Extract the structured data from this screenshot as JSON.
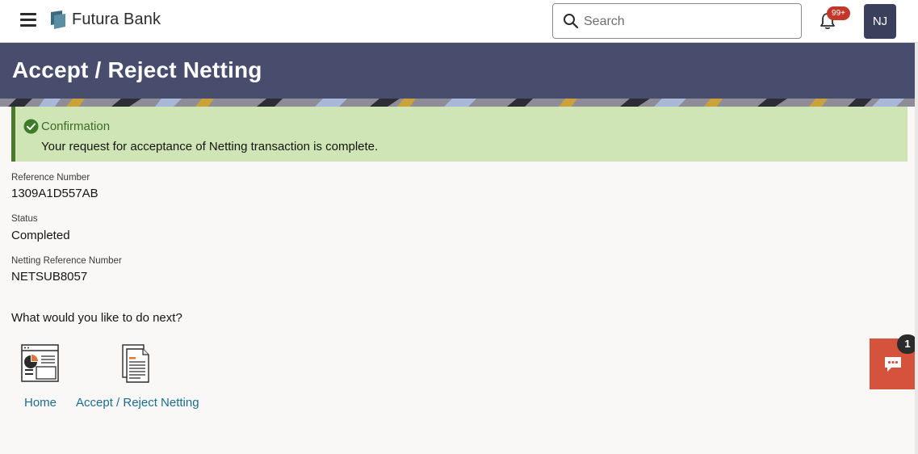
{
  "header": {
    "brand": "Futura Bank",
    "search_placeholder": "Search",
    "notification_count": "99+",
    "user_initials": "NJ"
  },
  "page": {
    "title": "Accept / Reject Netting"
  },
  "confirmation": {
    "title": "Confirmation",
    "message": "Your request for acceptance of Netting transaction is complete."
  },
  "details": {
    "reference_label": "Reference Number",
    "reference_value": "1309A1D557AB",
    "status_label": "Status",
    "status_value": "Completed",
    "netting_ref_label": "Netting Reference Number",
    "netting_ref_value": "NETSUB8057"
  },
  "next": {
    "title": "What would you like to do next?",
    "actions": [
      {
        "label": "Home",
        "icon": "dashboard-icon"
      },
      {
        "label": "Accept / Reject Netting",
        "icon": "document-icon"
      }
    ]
  },
  "chat": {
    "count": "1",
    "icon": "chat-icon"
  },
  "colors": {
    "title_band": "#484d6e",
    "confirm_bg": "#cfe5b5",
    "confirm_border": "#4b7a2c",
    "link": "#1a6c8e",
    "chat_bg": "#d5533d",
    "badge": "#c2372a"
  }
}
